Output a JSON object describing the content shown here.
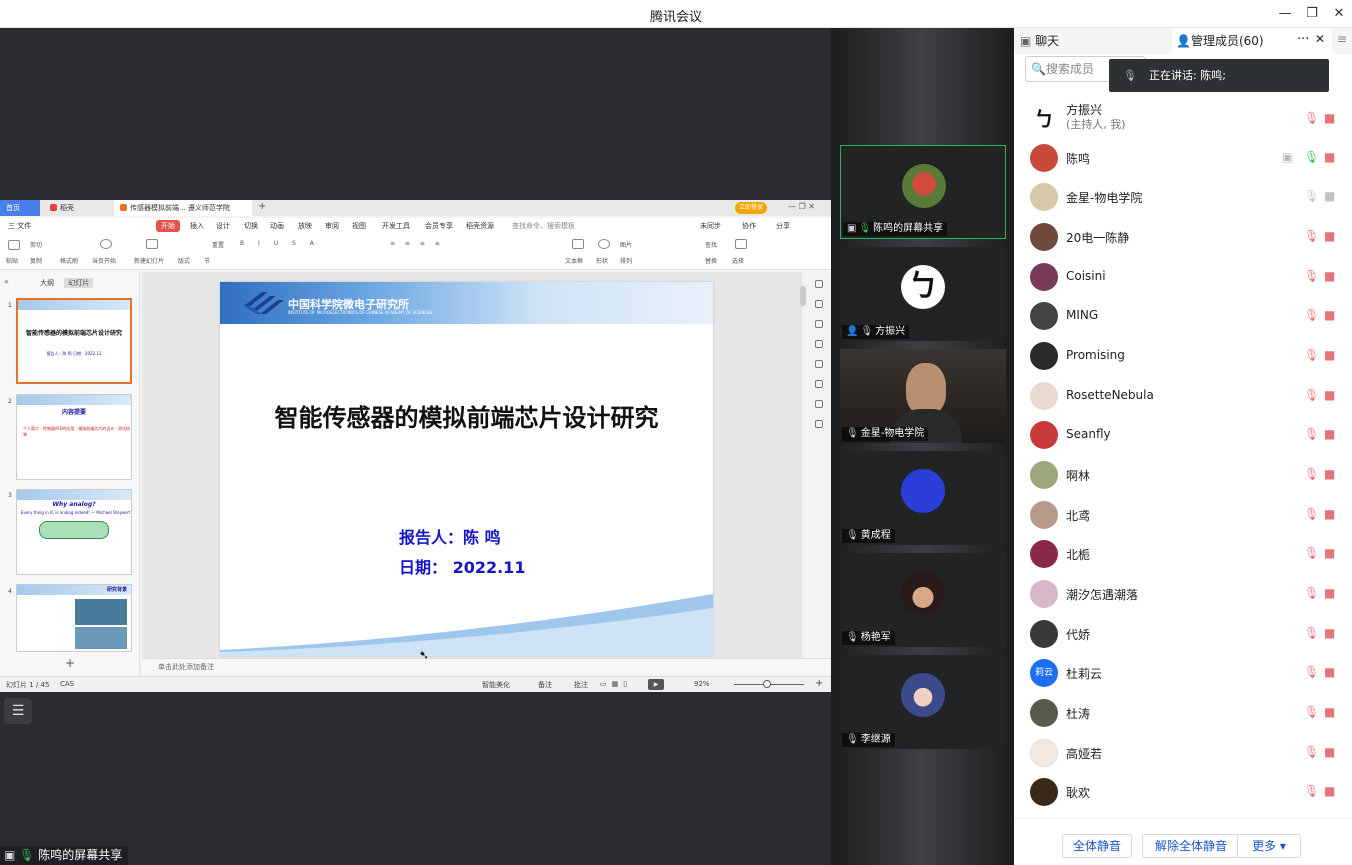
{
  "app": {
    "title": "腾讯会议"
  },
  "wps": {
    "tabs": [
      "首页",
      "稻壳",
      "传感器模拟前端...   遵义师范学院"
    ],
    "login": "立即登录",
    "menu": [
      "三 文件",
      "开始",
      "插入",
      "设计",
      "切换",
      "动画",
      "放映",
      "审阅",
      "视图",
      "开发工具",
      "会员专享",
      "稻壳资源",
      "查找命令、搜索模板",
      "未同步",
      "协作",
      "分享"
    ],
    "ribbon": [
      "粘贴",
      "剪切",
      "复制",
      "格式刷",
      "当页开始",
      "新建幻灯片",
      "版式",
      "节",
      "重置",
      "文本框",
      "形状",
      "图片",
      "排列",
      "查找",
      "替换",
      "选择"
    ],
    "outline_tabs": [
      "大纲",
      "幻灯片"
    ],
    "thumbs": [
      {
        "num": "1",
        "title": "智能传感器的模拟前端芯片设计研究",
        "sub": "报告人：陈 鸣   日期：2022.11"
      },
      {
        "num": "2",
        "title": "内容提要",
        "sub": "个人简介 · 传感器AFE的应用 · 模拟前端芯片的设计 · 测试结果"
      },
      {
        "num": "3",
        "title": "Why analog?",
        "sub": "Every thing in IC is analog indeed! — Michael Steyaert"
      },
      {
        "num": "4",
        "title": "研究背景",
        "sub": ""
      }
    ],
    "add_slide": "+",
    "notes": "单击此处添加备注",
    "status": {
      "slide_info": "幻灯片 1 / 45",
      "cas": "CAS",
      "beautify": "智能美化",
      "notes": "备注",
      "comment": "批注",
      "zoom": "92%"
    }
  },
  "slide": {
    "org_cn": "中国科学院微电子研究所",
    "org_en": "INSTITUTE OF MICROELECTRONICS OF CHINESE ACADEMY OF SCIENCES",
    "title": "智能传感器的模拟前端芯片设计研究",
    "reporter": "报告人：陈  鸣",
    "date": "日期：   2022.11"
  },
  "share_label": "陈鸣的屏幕共享",
  "video_tiles": [
    {
      "name": "陈鸣的屏幕共享",
      "mic": "on",
      "active": true
    },
    {
      "name": "方振兴",
      "mic": "muted"
    },
    {
      "name": "金星-物电学院",
      "mic": "plain"
    },
    {
      "name": "黄成程",
      "mic": "muted"
    },
    {
      "name": "杨艳军",
      "mic": "muted"
    },
    {
      "name": "李继源",
      "mic": "muted"
    }
  ],
  "panel": {
    "chat_tab": "聊天",
    "members_tab": "管理成员(60)",
    "search_placeholder": "搜索成员",
    "speaking": "正在讲话: 陈鸣;",
    "members": [
      {
        "name": "方振兴",
        "sub": "(主持人, 我)",
        "mic": "muted",
        "cam": "off-red",
        "color": "#ffffff"
      },
      {
        "name": "陈鸣",
        "mic": "on",
        "cam": "off-red",
        "screen": true,
        "color": "#c84a3a"
      },
      {
        "name": "金星-物电学院",
        "mic": "plain",
        "cam": "plain",
        "color": "#d6c8a8"
      },
      {
        "name": "20电一陈静",
        "mic": "muted",
        "cam": "off-red",
        "color": "#6d4a3a"
      },
      {
        "name": "Coisini",
        "mic": "muted",
        "cam": "off-red",
        "color": "#7a3a5a"
      },
      {
        "name": "MING",
        "mic": "muted",
        "cam": "off-red",
        "color": "#444"
      },
      {
        "name": "Promising",
        "mic": "muted",
        "cam": "off-red",
        "color": "#2a2a2a"
      },
      {
        "name": "RosetteNebula",
        "mic": "muted",
        "cam": "off-red",
        "color": "#e8d8d0"
      },
      {
        "name": "Seanfly",
        "mic": "muted",
        "cam": "off-red",
        "color": "#c83a3a"
      },
      {
        "name": "啊林",
        "mic": "muted",
        "cam": "off-red",
        "color": "#9aa87a"
      },
      {
        "name": "北鸢",
        "mic": "muted",
        "cam": "off-red",
        "color": "#b89a88"
      },
      {
        "name": "北栀",
        "mic": "muted",
        "cam": "off-red",
        "color": "#8a2a4a"
      },
      {
        "name": "潮汐怎遇潮落",
        "mic": "muted",
        "cam": "off-red",
        "color": "#d8b8c8"
      },
      {
        "name": "代娇",
        "mic": "muted",
        "cam": "off-red",
        "color": "#3a3a3a"
      },
      {
        "name": "杜莉云",
        "mic": "muted",
        "cam": "off-red",
        "color": "#1d6ff2",
        "initials": "莉云"
      },
      {
        "name": "杜涛",
        "mic": "muted",
        "cam": "off-red",
        "color": "#5a5a4a"
      },
      {
        "name": "高娅若",
        "mic": "muted",
        "cam": "off-red",
        "color": "#f2e8e0"
      },
      {
        "name": "耿欢",
        "mic": "muted",
        "cam": "off-red",
        "color": "#3a2a1a"
      }
    ],
    "footer": {
      "mute_all": "全体静音",
      "unmute_all": "解除全体静音",
      "more": "更多 ▾"
    }
  }
}
